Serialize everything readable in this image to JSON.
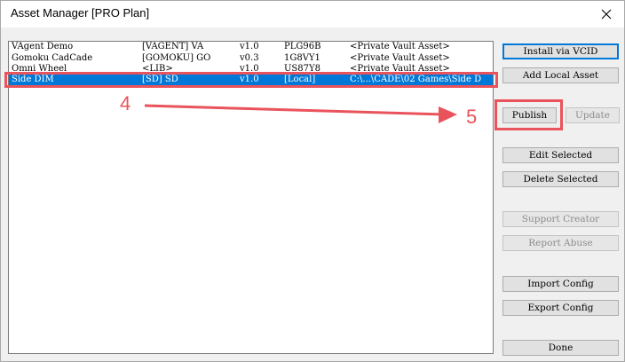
{
  "window": {
    "title": "Asset Manager [PRO Plan]",
    "close_glyph": "✕"
  },
  "assets": [
    {
      "name": "VAgent Demo",
      "tag": "[VAGENT] VA",
      "version": "v1.0",
      "code": "PLG96B",
      "source": "<Private Vault Asset>",
      "selected": false
    },
    {
      "name": "Gomoku CadCade",
      "tag": "[GOMOKU] GO",
      "version": "v0.3",
      "code": "1G8VY1",
      "source": "<Private Vault Asset>",
      "selected": false
    },
    {
      "name": "Omni Wheel",
      "tag": "<LIB>",
      "version": "v1.0",
      "code": "US87Y8",
      "source": "<Private Vault Asset>",
      "selected": false
    },
    {
      "name": "Side DIM",
      "tag": "[SD] SD",
      "version": "v1.0",
      "code": "[Local]",
      "source": "C:\\...\\CADE\\02 Games\\Side D",
      "selected": true
    }
  ],
  "buttons": {
    "install_vcid": "Install via VCID",
    "add_local": "Add Local Asset",
    "publish": "Publish",
    "update": "Update",
    "edit_selected": "Edit Selected",
    "delete_selected": "Delete Selected",
    "support_creator": "Support Creator",
    "report_abuse": "Report Abuse",
    "import_config": "Import Config",
    "export_config": "Export Config",
    "done": "Done"
  },
  "annotations": {
    "step_a": "4",
    "step_b": "5",
    "color": "#e9535b"
  }
}
